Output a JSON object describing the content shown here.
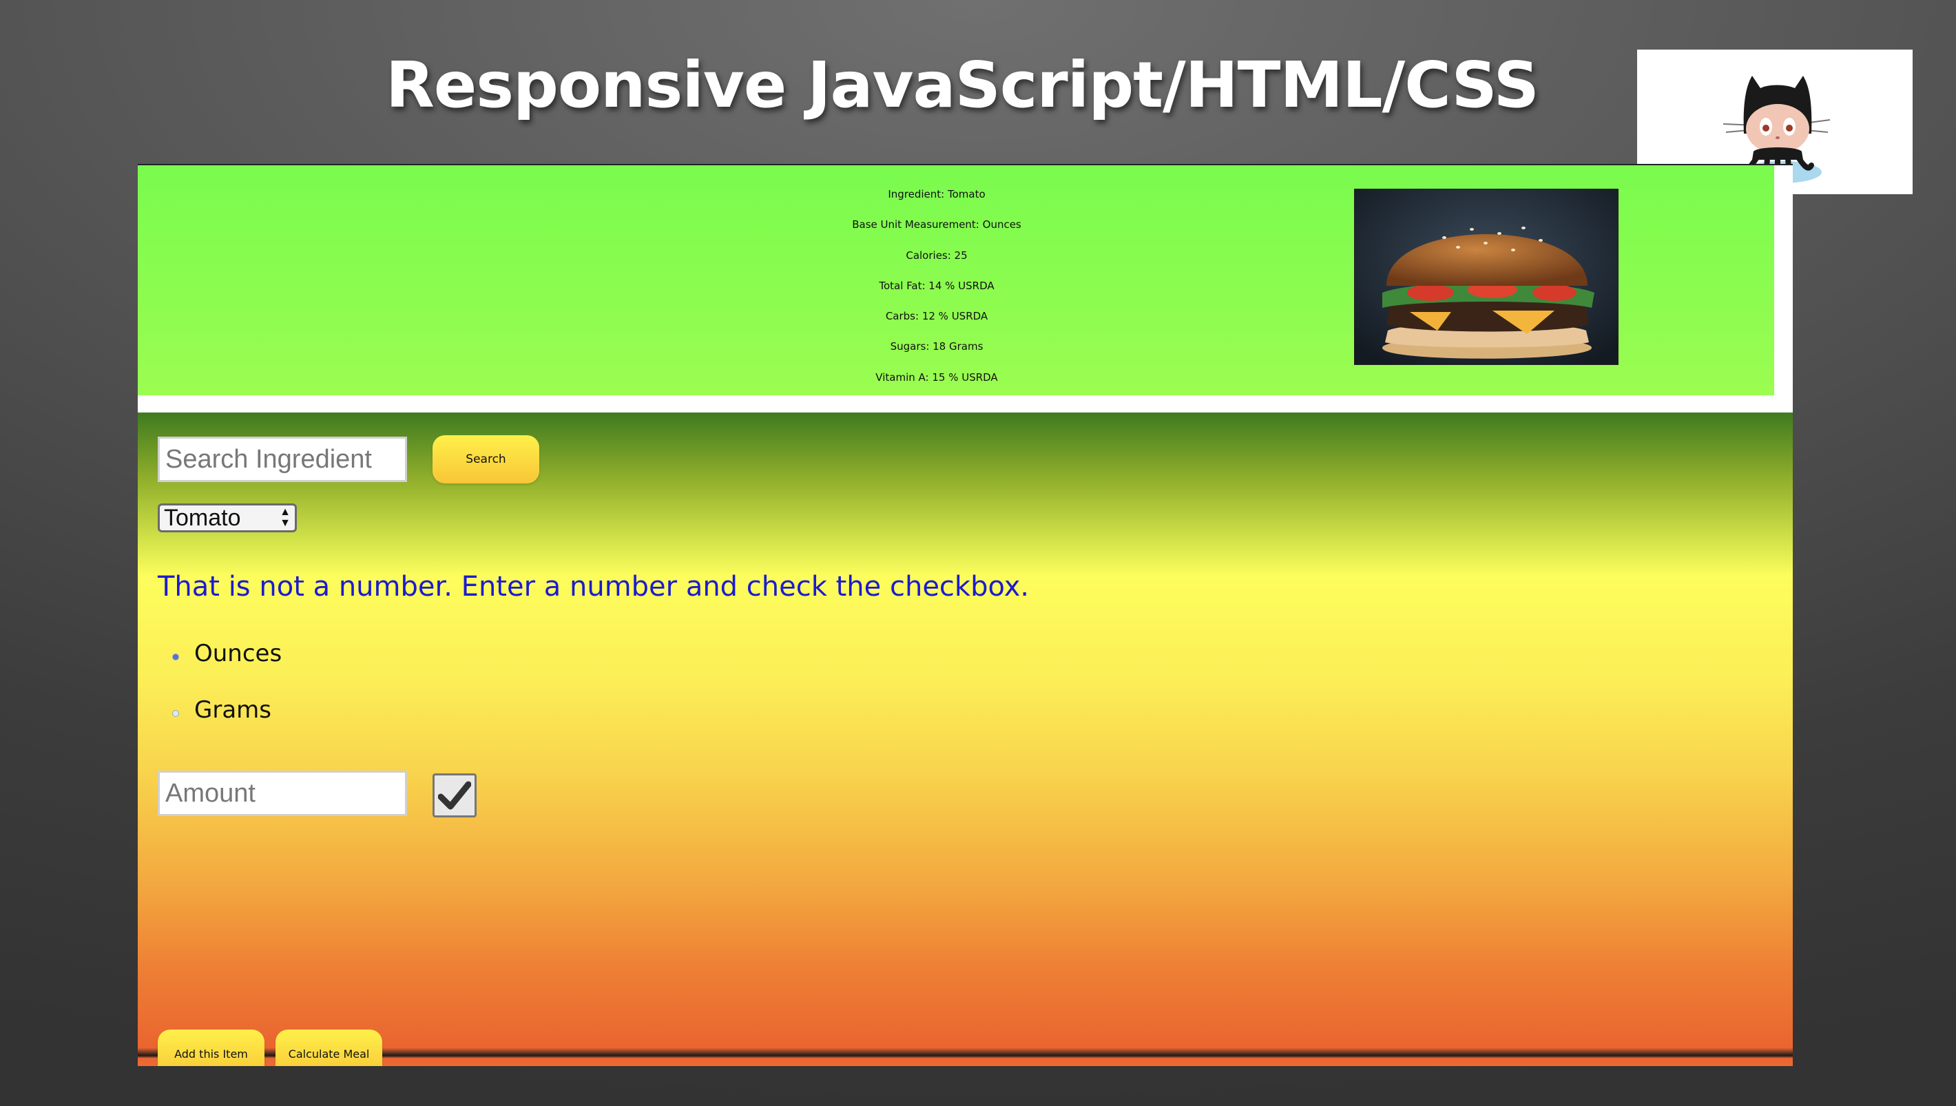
{
  "slide": {
    "title": "Responsive JavaScript/HTML/CSS"
  },
  "github_logo": {
    "icon": "github-octocat-icon"
  },
  "info_panel": {
    "items": [
      "Ingredient: Tomato",
      "Base Unit Measurement: Ounces",
      "Calories: 25",
      "Total Fat: 14 % USRDA",
      "Carbs: 12 % USRDA",
      "Sugars: 18 Grams",
      "Vitamin A: 15 % USRDA"
    ],
    "photo_icon": "burger-photo"
  },
  "form": {
    "search_placeholder": "Search Ingredient",
    "search_label": "Search",
    "selected_ingredient": "Tomato",
    "error_message": "That is not a number. Enter a number and check the checkbox.",
    "unit_options": [
      {
        "label": "Ounces",
        "checked": true
      },
      {
        "label": "Grams",
        "checked": false
      }
    ],
    "amount_placeholder": "Amount",
    "amount_checked": true,
    "add_label": "Add this Item",
    "calculate_label": "Calculate Meal"
  },
  "colors": {
    "info_panel_bg": "#79fb4e",
    "error_text": "#1b1bd0",
    "button_yellow": "#f8c637"
  }
}
